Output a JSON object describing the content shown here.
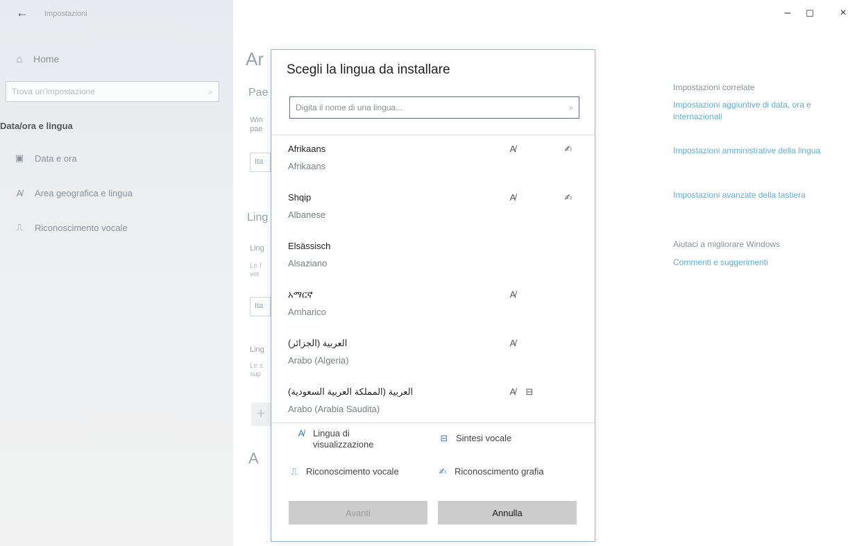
{
  "window": {
    "title": "Impostazioni",
    "controls": {
      "minimize": "–",
      "maximize": "☐",
      "close": "×"
    }
  },
  "sidebar": {
    "home_label": "Home",
    "search_placeholder": "Trova un'impostazione",
    "section_title": "Data/ora e lingua",
    "items": [
      {
        "label": "Data e ora",
        "icon": "calendar-icon"
      },
      {
        "label": "Area geografica e lingua",
        "icon": "language-icon"
      },
      {
        "label": "Riconoscimento vocale",
        "icon": "microphone-icon"
      }
    ]
  },
  "background_page": {
    "title_fragment": "Ar",
    "section1": "Pae",
    "desc1": [
      "Win",
      "pae"
    ],
    "box1": "Ita",
    "section2": "Ling",
    "sub2": "Ling",
    "desc2": [
      "Le f",
      "ver"
    ],
    "box2": "Ita",
    "sub3": "Ling",
    "desc3": [
      "Le s",
      "sup"
    ],
    "add": "+",
    "glyph": "A"
  },
  "related": {
    "heading": "Impostazioni correlate",
    "links": [
      "Impostazioni aggiuntive di data, ora e internazionali",
      "Impostazioni amministrative della lingua",
      "Impostazioni avanzate della tastiera"
    ],
    "help_heading": "Aiutaci a migliorare Windows",
    "help_link": "Commenti e suggerimenti"
  },
  "dialog": {
    "title": "Scegli la lingua da installare",
    "search_placeholder": "Digita il nome di una lingua...",
    "languages": [
      {
        "native": "Afrikaans",
        "italian": "Afrikaans",
        "features": [
          "display",
          "handwriting"
        ]
      },
      {
        "native": "Shqip",
        "italian": "Albanese",
        "features": [
          "display",
          "handwriting"
        ]
      },
      {
        "native": "Elsässisch",
        "italian": "Alsaziano",
        "features": []
      },
      {
        "native": "አማርኛ",
        "italian": "Amharico",
        "features": [
          "display"
        ]
      },
      {
        "native": "العربية (الجزائر)",
        "italian": "Arabo (Algeria)",
        "features": [
          "display"
        ]
      },
      {
        "native": "العربية (المملكة العربية السعودية)",
        "italian": "Arabo (Arabia Saudita)",
        "features": [
          "display",
          "tts"
        ]
      }
    ],
    "legend": {
      "display": "Lingua di visualizzazione",
      "tts": "Sintesi vocale",
      "speech": "Riconoscimento vocale",
      "handwriting": "Riconoscimento grafia"
    },
    "buttons": {
      "next": "Avanti",
      "cancel": "Annulla"
    }
  },
  "colors": {
    "accent": "#0078d7",
    "link": "#5fb0d9",
    "dialog_border": "#8db5d6"
  }
}
